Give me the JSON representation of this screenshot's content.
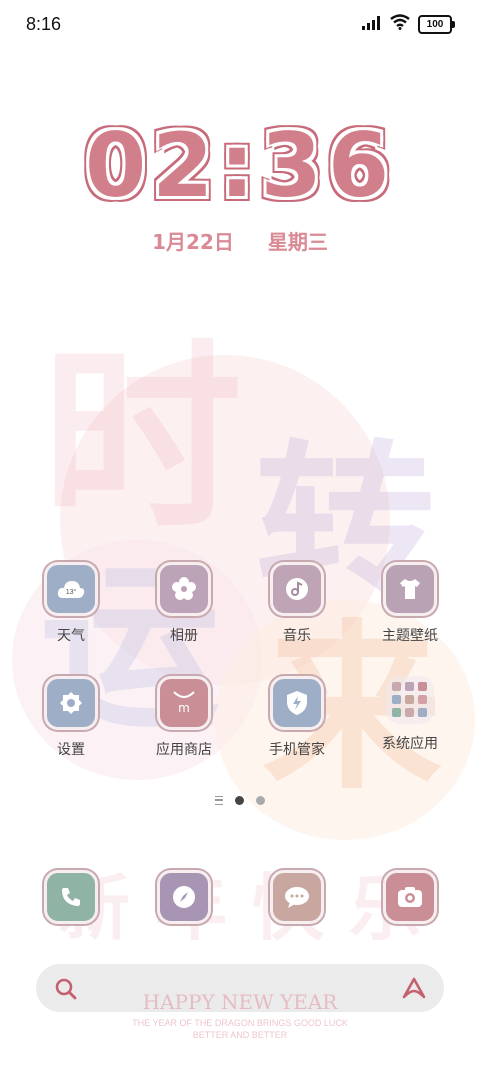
{
  "status_bar": {
    "time": "8:16",
    "battery": "100"
  },
  "clock": {
    "time": "02:36",
    "date": "1月22日",
    "weekday": "星期三"
  },
  "wallpaper": {
    "characters": [
      "时",
      "转",
      "运",
      "来"
    ],
    "bottom_characters": [
      "新",
      "年",
      "快",
      "乐"
    ],
    "greeting": "HAPPY NEW YEAR",
    "line1": "THE YEAR OF THE DRAGON BRINGS GOOD LUCK",
    "line2": "BETTER AND BETTER"
  },
  "apps": [
    {
      "label": "天气",
      "icon": "weather-icon",
      "badge": "13°"
    },
    {
      "label": "相册",
      "icon": "flower-icon"
    },
    {
      "label": "音乐",
      "icon": "music-icon"
    },
    {
      "label": "主题壁纸",
      "icon": "shirt-icon"
    },
    {
      "label": "设置",
      "icon": "gear-icon"
    },
    {
      "label": "应用商店",
      "icon": "store-bag-icon"
    },
    {
      "label": "手机管家",
      "icon": "shield-bolt-icon"
    },
    {
      "label": "系统应用",
      "icon": "app-folder-icon"
    }
  ],
  "dock": [
    {
      "icon": "phone-icon"
    },
    {
      "icon": "compass-icon"
    },
    {
      "icon": "message-icon"
    },
    {
      "icon": "camera-icon"
    }
  ],
  "page_indicator": {
    "pages": 2,
    "current": 1
  },
  "colors": {
    "clock_pink": "#d27f8c",
    "icon_blue": "#9eaec6",
    "icon_mauve": "#bda3b7",
    "icon_rose": "#c98e96",
    "icon_sage": "#8fb3a4",
    "icon_tan": "#c7a7a0"
  }
}
